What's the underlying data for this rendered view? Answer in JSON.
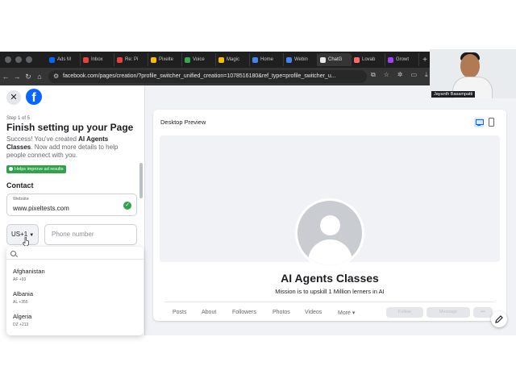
{
  "browser": {
    "tabs": [
      {
        "label": "Ads M",
        "color": "#0866ff"
      },
      {
        "label": "Inbox",
        "color": "#ea4335"
      },
      {
        "label": "Re: Pi",
        "color": "#ea4335"
      },
      {
        "label": "Pixelte",
        "color": "#fbbc04"
      },
      {
        "label": "Voice",
        "color": "#34a853"
      },
      {
        "label": "Magic",
        "color": "#fbbc04"
      },
      {
        "label": "Home",
        "color": "#4285f4"
      },
      {
        "label": "Webin",
        "color": "#4285f4"
      },
      {
        "label": "ChatG",
        "color": "#e8eaed"
      },
      {
        "label": "Lovab",
        "color": "#ff6b6b"
      },
      {
        "label": "Growt",
        "color": "#a142f4"
      }
    ],
    "new_tab": "+",
    "url": "facebook.com/pages/creation/?profile_switcher_unified_creation=1078516180&ref_type=profile_switcher_u..."
  },
  "setup": {
    "step": "Step 1 of 5",
    "title": "Finish setting up your Page",
    "desc_prefix": "Success! You've created ",
    "page_name_bold": "AI Agents Classes",
    "desc_suffix": ". Now add more details to help people connect with you.",
    "badge": "Helps improve ad results",
    "contact_heading": "Contact",
    "website_label": "Website",
    "website_value": "www.pixeltests.com",
    "country_code": "US+1",
    "phone_placeholder": "Phone number",
    "countries": [
      {
        "name": "Afghanistan",
        "code": "AF +93"
      },
      {
        "name": "Albania",
        "code": "AL +355"
      },
      {
        "name": "Algeria",
        "code": "DZ +213"
      }
    ]
  },
  "preview": {
    "title": "Desktop Preview",
    "page_name": "AI Agents Classes",
    "mission": "Mission is to upskill 1 Million lerners in AI",
    "nav": [
      "Posts",
      "About",
      "Followers",
      "Photos",
      "Videos",
      "More"
    ],
    "buttons": [
      "Follow",
      "Message"
    ]
  },
  "webcam": {
    "name": "Jayanth Basampatti"
  },
  "colors": {
    "facebook_blue": "#0866ff",
    "success_green": "#31a24c",
    "page_bg": "#f0f2f5"
  }
}
